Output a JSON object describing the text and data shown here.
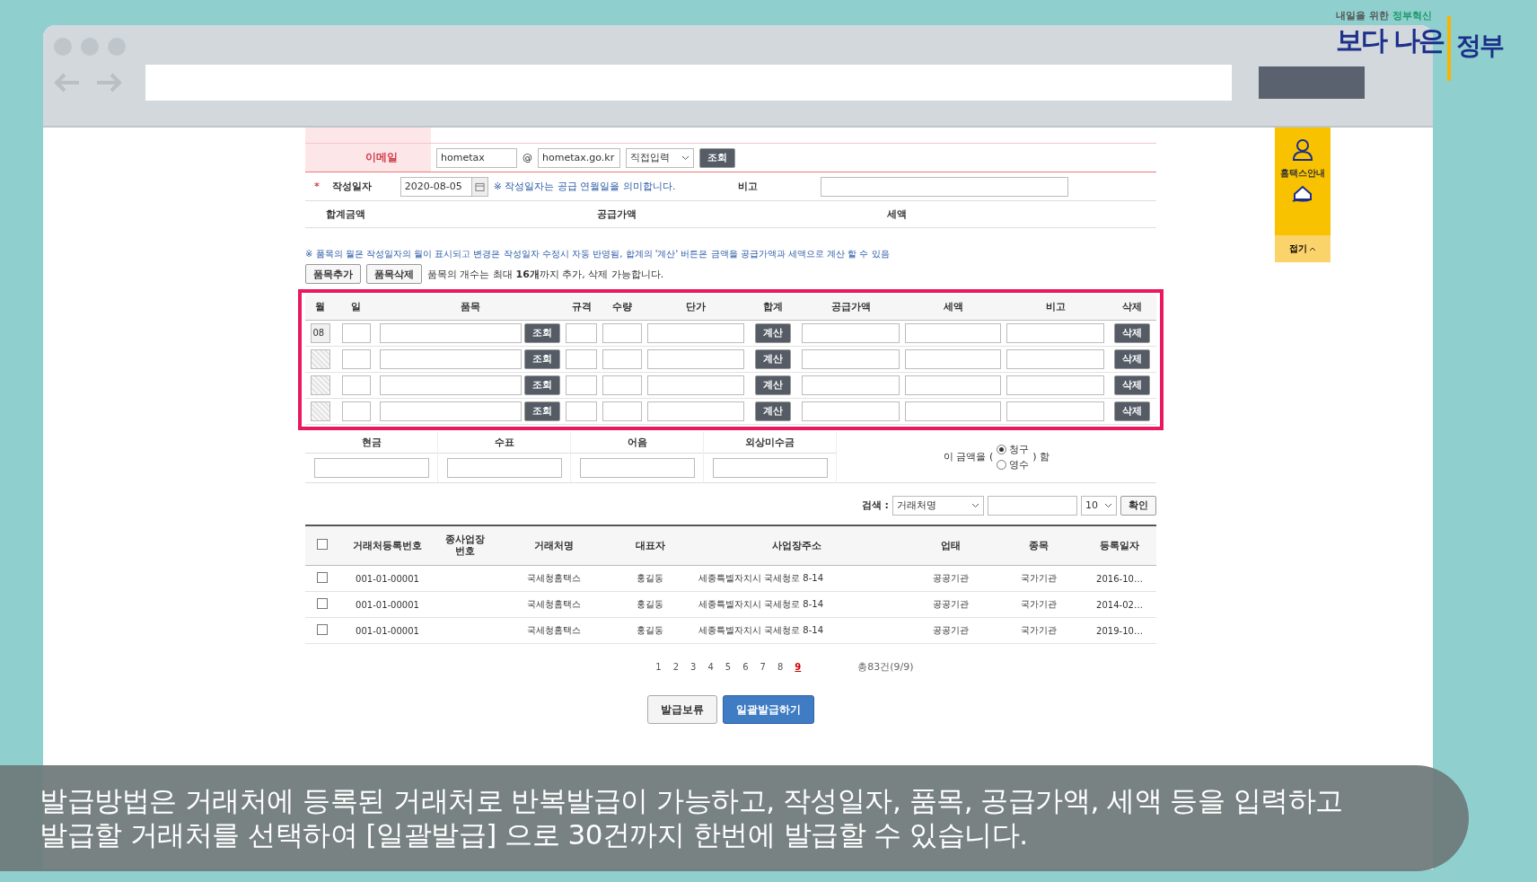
{
  "logo": {
    "tagline_1": "내일을 위한",
    "tagline_2": "정부혁신",
    "title_1": "보다 나은",
    "title_2": "정부"
  },
  "email": {
    "label": "이메일",
    "user": "hometax",
    "at": "@",
    "domain": "hometax.go.kr",
    "domain_select": "직접입력",
    "button": "조회"
  },
  "date": {
    "required_mark": "*",
    "label": "작성일자",
    "value": "2020-08-05",
    "note": "※ 작성일자는 공급 연월일을 의미합니다.",
    "remark_label": "비고"
  },
  "totals": [
    "합계금액",
    "공급가액",
    "세액"
  ],
  "item_note": "※ 품목의 월은 작성일자의 월이 표시되고 변경은 작성일자 수정시 자동 반영됨, 합계의 '계산' 버튼은 금액을 공급가액과 세액으로 계산 할 수 있음",
  "item_buttons": [
    "품목추가",
    "품목삭제"
  ],
  "item_limit": "품목의 개수는 최대 **16개**까지 추가, 삭제 가능합니다.",
  "items": {
    "highlighted": true,
    "columns": [
      "월",
      "일",
      "품목",
      "규격",
      "수량",
      "단가",
      "합계",
      "공급가액",
      "세액",
      "비고",
      "삭제"
    ],
    "rows": [
      {
        "month": "08",
        "month_disabled": false,
        "lookup": "조회",
        "calc": "계산",
        "delete": "삭제"
      },
      {
        "month_disabled": true,
        "lookup": "조회",
        "calc": "계산",
        "delete": "삭제"
      },
      {
        "month_disabled": true,
        "lookup": "조회",
        "calc": "계산",
        "delete": "삭제"
      },
      {
        "month_disabled": true,
        "lookup": "조회",
        "calc": "계산",
        "delete": "삭제"
      }
    ]
  },
  "payment": {
    "columns": [
      "현금",
      "수표",
      "어음",
      "외상미수금"
    ],
    "prefix": "이 금액을 (",
    "options": [
      {
        "label": "청구",
        "selected": true
      },
      {
        "label": "영수",
        "selected": false
      }
    ],
    "suffix": ") 함"
  },
  "search": {
    "label": "검색 :",
    "field": "거래처명",
    "page_size": "10",
    "button": "확인"
  },
  "partners": {
    "columns": [
      "거래처등록번호",
      "종사업장 번호",
      "거래처명",
      "대표자",
      "사업장주소",
      "업태",
      "종목",
      "등록일자"
    ],
    "all_checked": false,
    "rows": [
      {
        "checked": false,
        "cells": [
          "001-01-00001",
          "",
          "국세청홈택스",
          "홍길동",
          "세종특별자치시 국세청로 8-14",
          "공공기관",
          "국가기관",
          "2016-10…"
        ]
      },
      {
        "checked": false,
        "cells": [
          "001-01-00001",
          "",
          "국세청홈택스",
          "홍길동",
          "세종특별자치시 국세청로 8-14",
          "공공기관",
          "국가기관",
          "2014-02…"
        ]
      },
      {
        "checked": false,
        "cells": [
          "001-01-00001",
          "",
          "국세청홈택스",
          "홍길동",
          "세종특별자치시 국세청로 8-14",
          "공공기관",
          "국가기관",
          "2019-10…"
        ]
      }
    ]
  },
  "pagination": {
    "pages": [
      {
        "label": "1",
        "selected": false
      },
      {
        "label": "2",
        "selected": false
      },
      {
        "label": "3",
        "selected": false
      },
      {
        "label": "4",
        "selected": false
      },
      {
        "label": "5",
        "selected": false
      },
      {
        "label": "6",
        "selected": false
      },
      {
        "label": "7",
        "selected": false
      },
      {
        "label": "8",
        "selected": false
      },
      {
        "label": "9",
        "selected": true
      }
    ],
    "total": "총83건(9/9)"
  },
  "actions": [
    {
      "label": "발급보류",
      "kind": "plain"
    },
    {
      "label": "일괄발급하기",
      "kind": "primary"
    }
  ],
  "sidebar": {
    "label": "홈택스안내",
    "collapse": "접기"
  },
  "subtitle": [
    "발급방법은 거래처에 등록된 거래처로 반복발급이 가능하고, 작성일자, 품목, 공급가액, 세액 등을 입력하고",
    "발급할 거래처를 선택하여 [일괄발급] 으로 30건까지 한번에 발급할 수 있습니다."
  ]
}
